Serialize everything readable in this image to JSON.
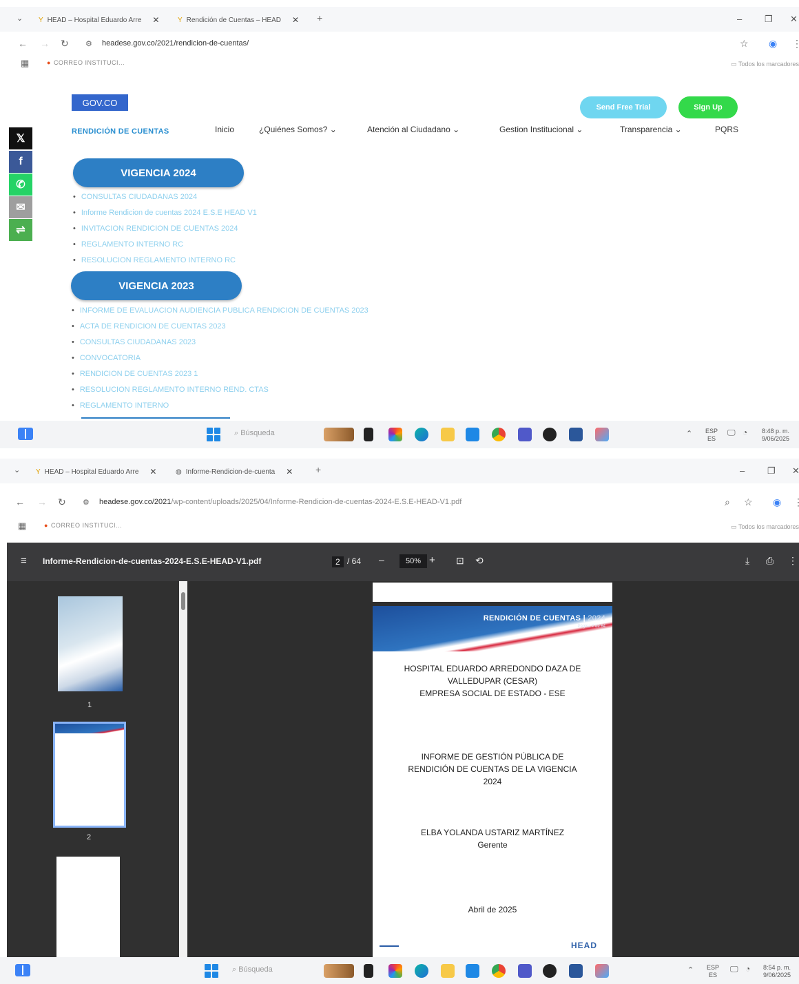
{
  "shot1": {
    "tabs": [
      {
        "label": "HEAD – Hospital Eduardo Arre"
      },
      {
        "label": "Rendición de Cuentas – HEAD"
      }
    ],
    "url": "headese.gov.co/2021/rendicion-de-cuentas/",
    "bookmarks": {
      "mail": "CORREO INSTITUCI...",
      "all": "Todos los marcadores"
    },
    "site": {
      "logo": "GOV.CO",
      "title": "RENDICIÓN DE CUENTAS",
      "nav": [
        "Inicio",
        "¿Quiénes Somos?",
        "Atención al Ciudadano",
        "Gestion Institucional",
        "Transparencia",
        "PQRS"
      ],
      "cta": {
        "trial": "Send Free Trial",
        "signup": "Sign Up"
      },
      "sections": [
        {
          "heading": "VIGENCIA 2024",
          "items": [
            "CONSULTAS CIUDADANAS 2024",
            "Informe Rendicion de cuentas 2024 E.S.E HEAD V1",
            "INVITACION RENDICION DE CUENTAS 2024",
            "REGLAMENTO INTERNO RC",
            "RESOLUCION REGLAMENTO INTERNO RC"
          ]
        },
        {
          "heading": "VIGENCIA 2023",
          "items": [
            "INFORME DE EVALUACION AUDIENCIA PUBLICA RENDICION DE CUENTAS 2023",
            "ACTA DE RENDICION DE CUENTAS 2023",
            "CONSULTAS CIUDADANAS 2023",
            "CONVOCATORIA",
            "RENDICION DE CUENTAS 2023 1",
            "RESOLUCION REGLAMENTO INTERNO REND. CTAS",
            "REGLAMENTO INTERNO"
          ]
        }
      ]
    },
    "taskbar": {
      "search": "Búsqueda",
      "lang": "ESP",
      "lang2": "ES",
      "time": "8:48 p. m.",
      "date": "9/06/2025"
    }
  },
  "shot2": {
    "tabs": [
      {
        "label": "HEAD – Hospital Eduardo Arre"
      },
      {
        "label": "Informe-Rendicion-de-cuenta"
      }
    ],
    "url_host": "headese.gov.co/2021",
    "url_path": "/wp-content/uploads/2025/04/Informe-Rendicion-de-cuentas-2024-E.S.E-HEAD-V1.pdf",
    "bookmarks": {
      "mail": "CORREO INSTITUCI...",
      "all": "Todos los marcadores"
    },
    "pdf": {
      "filename": "Informe-Rendicion-de-cuentas-2024-E.S.E-HEAD-V1.pdf",
      "page_current": "2",
      "page_total": "/ 64",
      "zoom": "50%",
      "thumb_numbers": [
        "1",
        "2"
      ],
      "doc": {
        "band_title": "RENDICIÓN DE CUENTAS",
        "band_year": "2024",
        "band_sub": "Página 2 de 64",
        "hospital": [
          "HOSPITAL EDUARDO ARREDONDO DAZA DE",
          "VALLEDUPAR (CESAR)",
          "EMPRESA SOCIAL DE ESTADO - ESE"
        ],
        "report": [
          "INFORME DE GESTIÓN PÚBLICA DE",
          "RENDICIÓN DE CUENTAS DE LA VIGENCIA",
          "2024"
        ],
        "person": "ELBA YOLANDA USTARIZ MARTÍNEZ",
        "role": "Gerente",
        "date": "Abril de 2025",
        "footer_logo": "HEAD"
      }
    },
    "taskbar": {
      "search": "Búsqueda",
      "lang": "ESP",
      "lang2": "ES",
      "time": "8:54 p. m.",
      "date": "9/06/2025"
    }
  },
  "colors": {
    "accent": "#2d7fc5",
    "link": "#8ed0ee",
    "trial": "#6fd6f0",
    "signup": "#33d94a",
    "pdf_toolbar": "#3a3a3c"
  }
}
